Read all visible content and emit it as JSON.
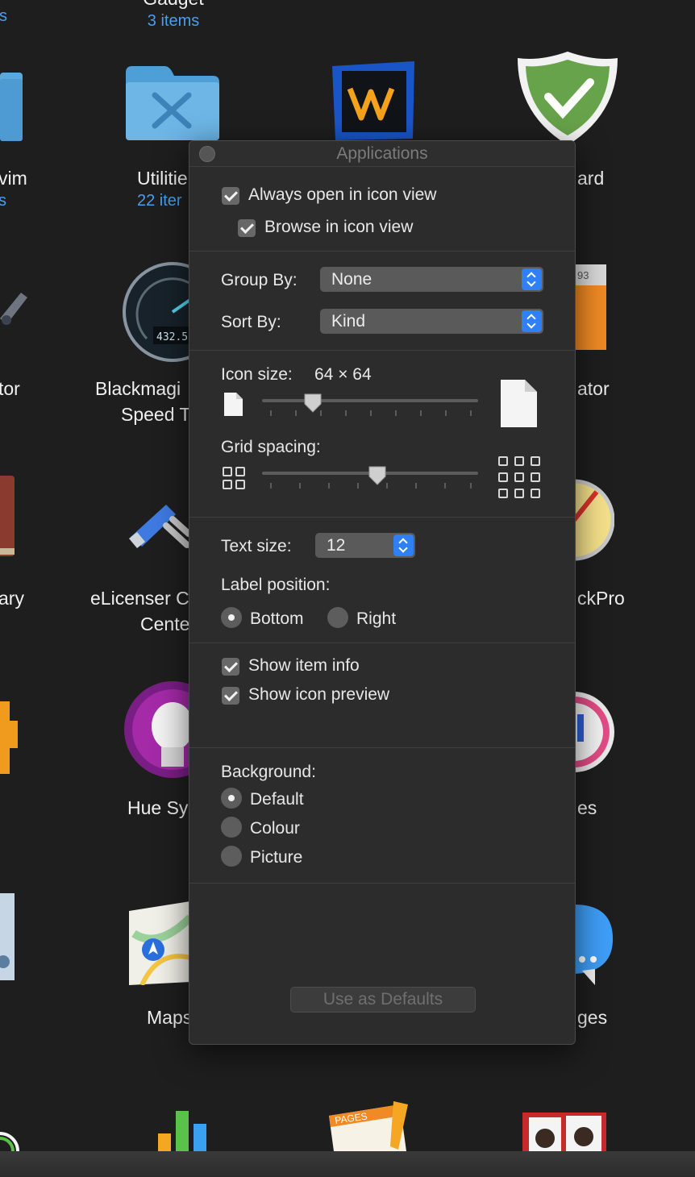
{
  "background": {
    "top_item": {
      "name": "Gadget",
      "count": "3 items"
    },
    "left_count_fragment": "s",
    "labels": {
      "vim": "vim",
      "vim_sub": "s",
      "utilities": "Utilitie",
      "utilities_sub": "22 iter",
      "ard": "ard",
      "tor": "tor",
      "blackmagic_1": "Blackmagi",
      "blackmagic_2": "Speed T",
      "ator": "ator",
      "ary": "ary",
      "elicenser_1": "eLicenser C",
      "elicenser_2": "Cente",
      "ckpro": "ckPro",
      "hue": "Hue Sy",
      "es": "es",
      "maps": "Maps",
      "ges": "ges"
    },
    "speedometer_text": "432.5",
    "calculator_text": "93",
    "pages_label": "PAGES"
  },
  "panel": {
    "title": "Applications",
    "always_open": {
      "label": "Always open in icon view",
      "checked": true
    },
    "browse": {
      "label": "Browse in icon view",
      "checked": true
    },
    "group_by": {
      "label": "Group By:",
      "value": "None"
    },
    "sort_by": {
      "label": "Sort By:",
      "value": "Kind"
    },
    "icon_size": {
      "label": "Icon size:",
      "value": "64 × 64",
      "slider_fraction": 0.23
    },
    "grid_spacing": {
      "label": "Grid spacing:",
      "slider_fraction": 0.53
    },
    "text_size": {
      "label": "Text size:",
      "value": "12"
    },
    "label_position": {
      "label": "Label position:",
      "options": [
        {
          "label": "Bottom",
          "selected": true
        },
        {
          "label": "Right",
          "selected": false
        }
      ]
    },
    "show_item_info": {
      "label": "Show item info",
      "checked": true
    },
    "show_icon_preview": {
      "label": "Show icon preview",
      "checked": true
    },
    "background": {
      "label": "Background:",
      "options": [
        {
          "label": "Default",
          "selected": true
        },
        {
          "label": "Colour",
          "selected": false
        },
        {
          "label": "Picture",
          "selected": false
        }
      ]
    },
    "use_as_defaults": "Use as Defaults"
  },
  "colors": {
    "accent": "#2f7ff5",
    "link_blue": "#4a9df0",
    "panel_bg": "#2c2c2c",
    "desktop_bg": "#1e1e1e"
  }
}
